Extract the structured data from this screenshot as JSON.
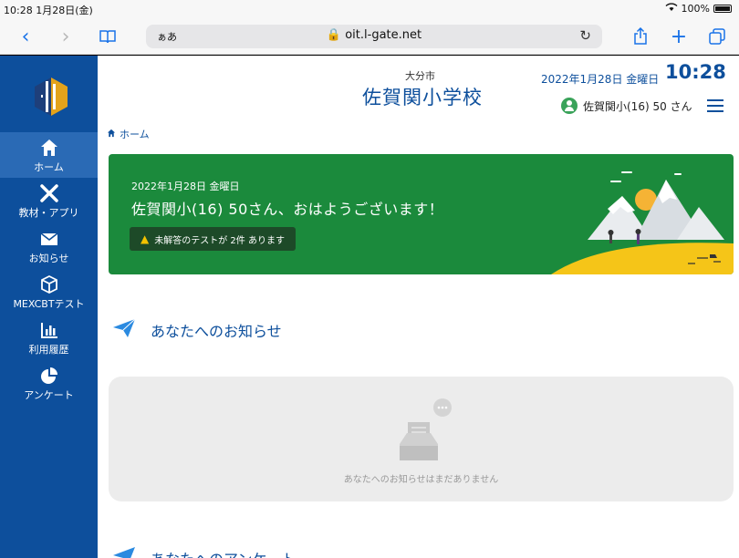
{
  "status_bar": {
    "time_date": "10:28  1月28日(金)",
    "battery": "100%"
  },
  "browser": {
    "aa": "ぁあ",
    "url": "oit.l-gate.net"
  },
  "sidebar": {
    "items": [
      {
        "label": "ホーム"
      },
      {
        "label": "教材・アプリ"
      },
      {
        "label": "お知らせ"
      },
      {
        "label": "MEXCBTテスト"
      },
      {
        "label": "利用履歴"
      },
      {
        "label": "アンケート"
      }
    ]
  },
  "header": {
    "city": "大分市",
    "school": "佐賀関小学校",
    "date": "2022年1月28日 金曜日",
    "time": "10:28",
    "user": "佐賀関小(16) 50 さん"
  },
  "breadcrumb": {
    "home": "ホーム"
  },
  "banner": {
    "date": "2022年1月28日 金曜日",
    "greeting": "佐賀関小(16) 50さん、おはようございます！",
    "alert": "未解答のテストが 2件 あります"
  },
  "notices": {
    "title": "あなたへのお知らせ",
    "empty": "あなたへのお知らせはまだありません"
  },
  "surveys": {
    "title": "あなたへのアンケート"
  },
  "colors": {
    "brand": "#0d4f9c",
    "banner": "#1b8a3c",
    "accent": "#f2c200"
  }
}
